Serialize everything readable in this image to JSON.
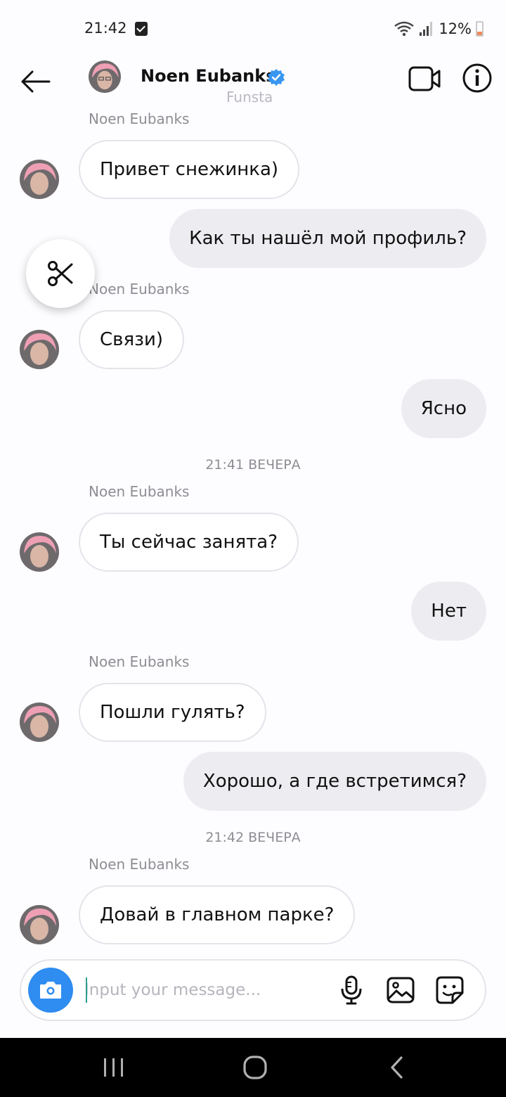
{
  "status_bar": {
    "time": "21:42",
    "battery": "12%"
  },
  "header": {
    "name": "Noen Eubanks",
    "subtitle": "Funsta"
  },
  "messages": [
    {
      "sender": "Noen Eubanks",
      "text": "Привет снежинка)"
    },
    {
      "text": "Как ты нашёл мой профиль?"
    },
    {
      "sender": "Noen Eubanks",
      "text": "Связи)"
    },
    {
      "text": "Ясно"
    },
    {
      "timestamp": "21:41 ВЕЧЕРА"
    },
    {
      "sender": "Noen Eubanks",
      "text": "Ты сейчас занята?"
    },
    {
      "text": "Нет"
    },
    {
      "sender": "Noen Eubanks",
      "text": "Пошли гулять?"
    },
    {
      "text": "Хорошо, а где встретимся?"
    },
    {
      "timestamp": "21:42 ВЕЧЕРА"
    },
    {
      "sender": "Noen Eubanks",
      "text": "Довай в главном парке?"
    }
  ],
  "composer": {
    "placeholder": "Input your message..."
  },
  "colors": {
    "accent": "#2f8cf0",
    "verified": "#3897f0",
    "outgoing_bubble": "#ededf1",
    "caret": "#2a9d8f"
  },
  "icons": {
    "back": "arrow-left-icon",
    "video": "video-camera-icon",
    "info": "info-icon",
    "scissors": "scissors-icon",
    "camera": "camera-icon",
    "mic": "microphone-icon",
    "gallery": "image-icon",
    "sticker": "sticker-icon"
  }
}
